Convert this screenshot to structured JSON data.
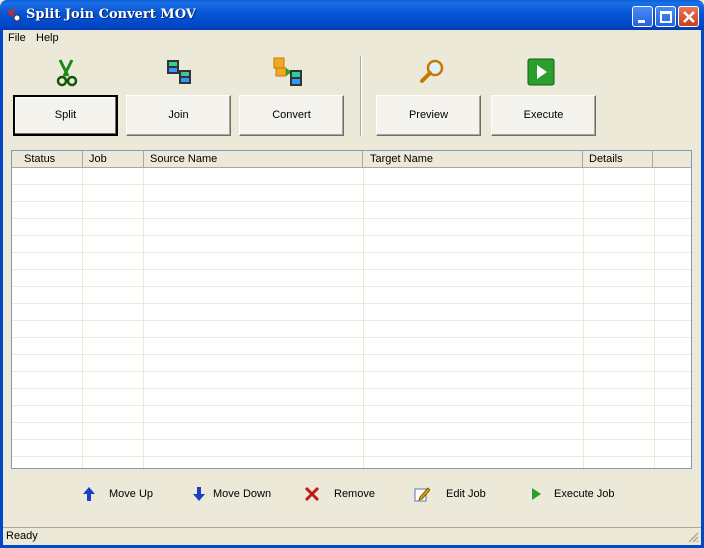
{
  "window": {
    "title": "Split Join Convert MOV"
  },
  "menu": {
    "file": "File",
    "help": "Help"
  },
  "toolbar": {
    "split": "Split",
    "join": "Join",
    "convert": "Convert",
    "preview": "Preview",
    "execute": "Execute"
  },
  "table": {
    "columns": [
      "Status",
      "Job",
      "Source Name",
      "Target Name",
      "Details"
    ]
  },
  "actions": {
    "move_up": "Move Up",
    "move_down": "Move Down",
    "remove": "Remove",
    "edit_job": "Edit Job",
    "execute_job": "Execute Job"
  },
  "status": {
    "text": "Ready"
  },
  "icons": {
    "split": "scissors-icon",
    "join": "film-join-icon",
    "convert": "convert-icon",
    "preview": "magnifier-icon",
    "execute": "play-icon"
  },
  "colors": {
    "titlebar": "#0554d4",
    "face": "#ece9d8",
    "accent_green": "#2c9e2c"
  }
}
